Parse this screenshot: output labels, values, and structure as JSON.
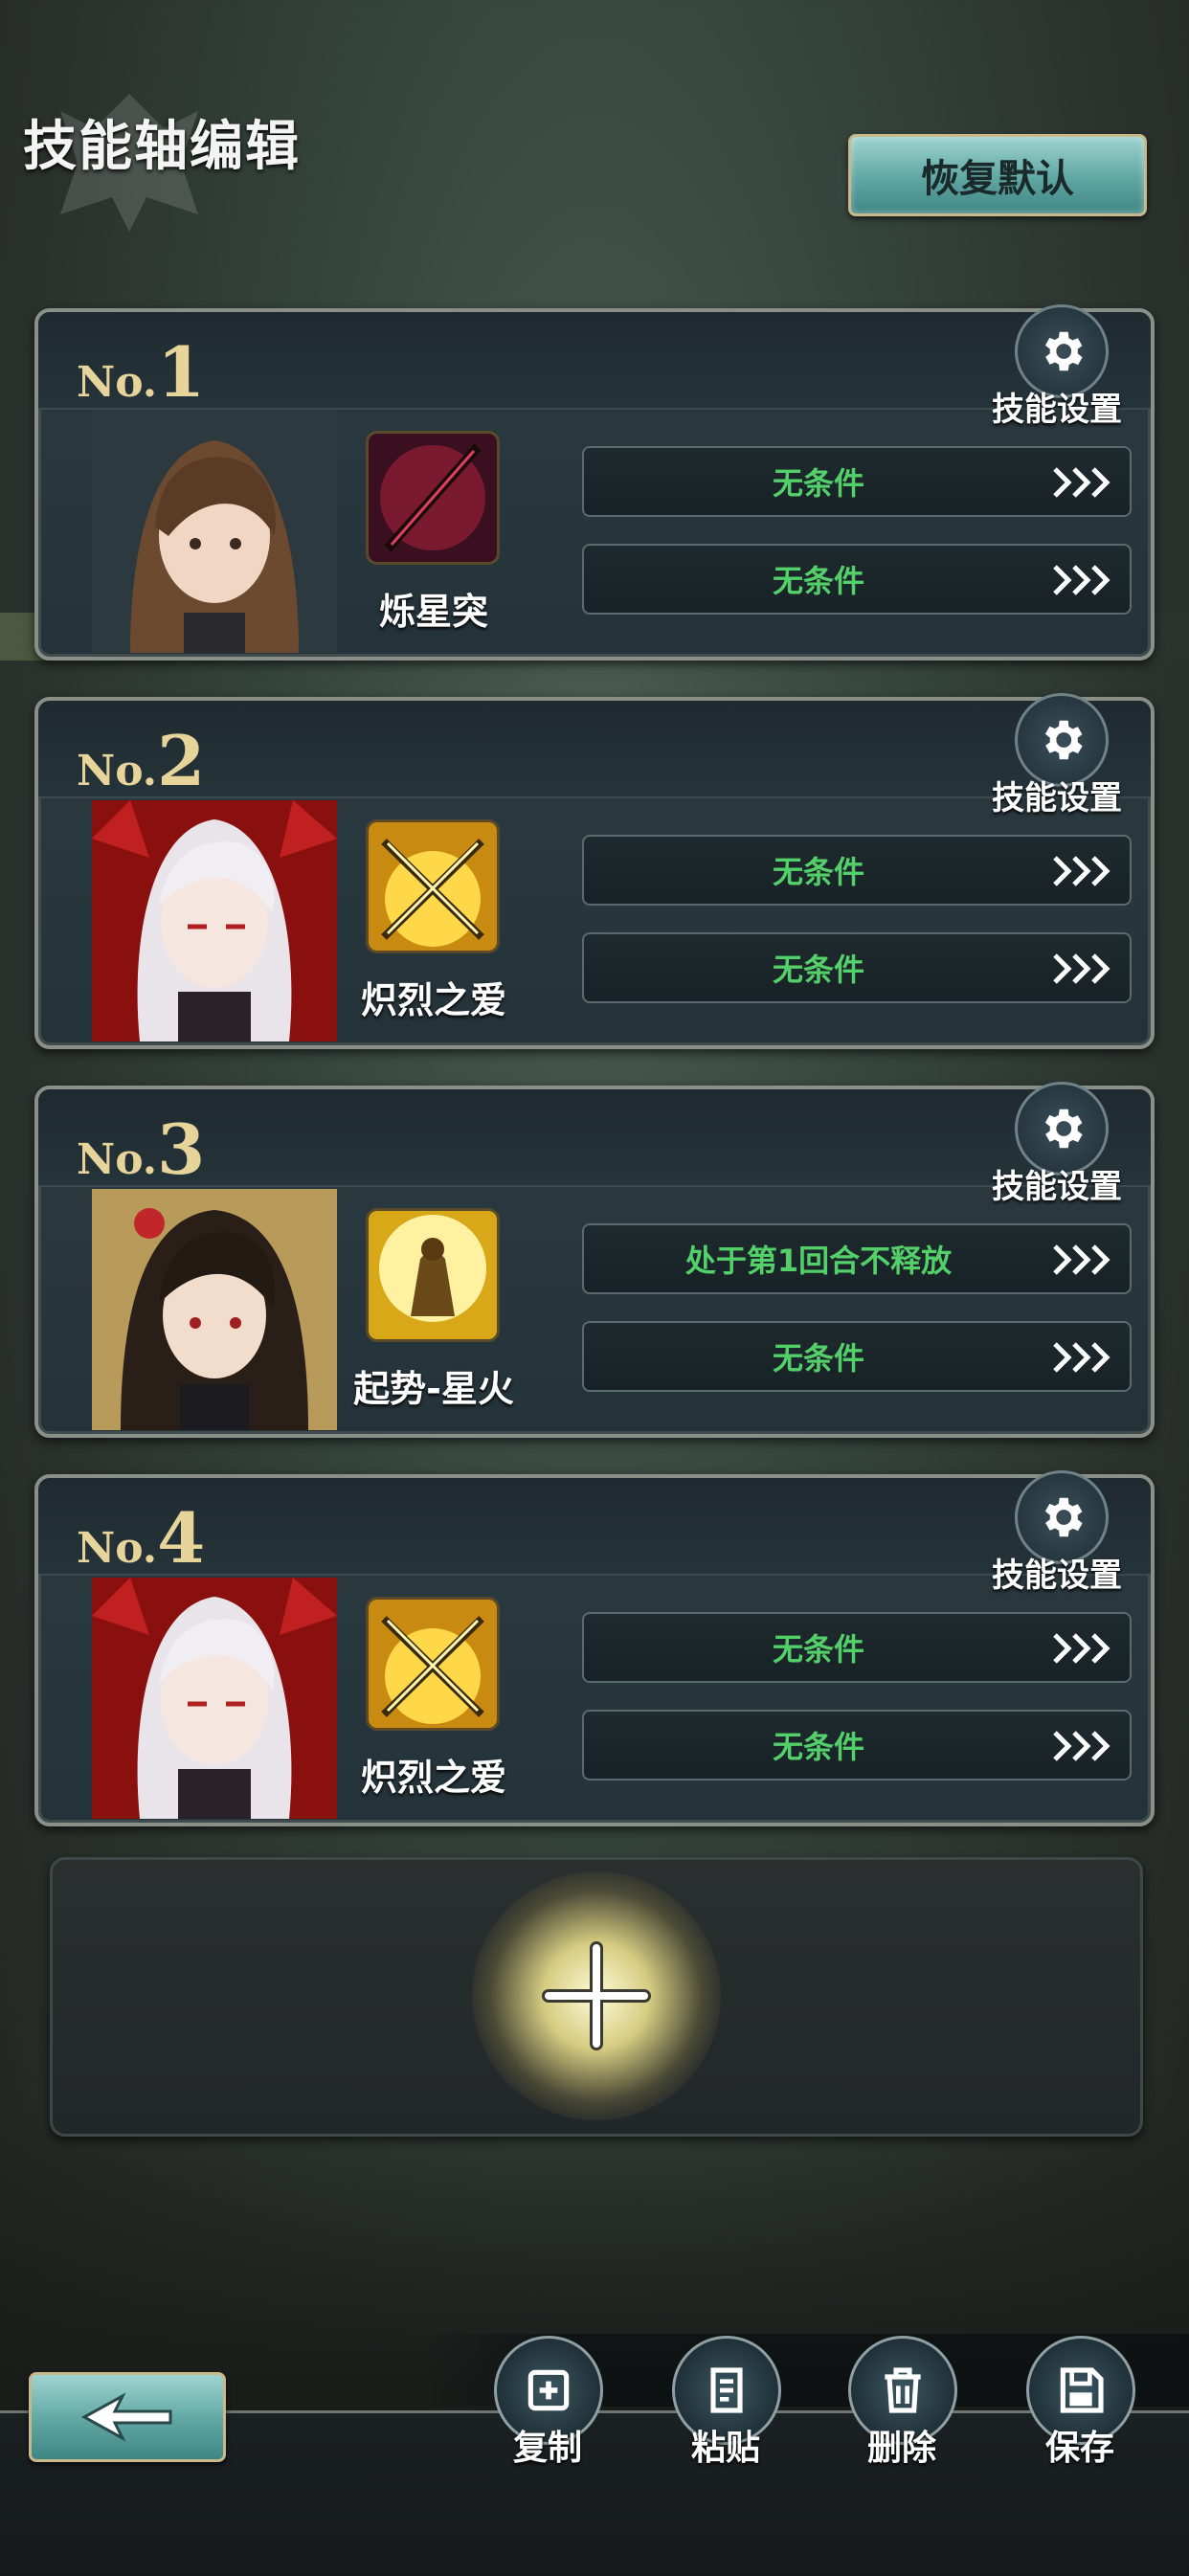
{
  "header": {
    "title": "技能轴编辑",
    "reset_label": "恢复默认"
  },
  "cards": [
    {
      "no_prefix": "No.",
      "number": "1",
      "gear_label": "技能设置",
      "skill_name": "烁星突",
      "skill_theme": "crimson-spear",
      "conditions": [
        "无条件",
        "无条件"
      ]
    },
    {
      "no_prefix": "No.",
      "number": "2",
      "gear_label": "技能设置",
      "skill_name": "炽烈之爱",
      "skill_theme": "golden-blades",
      "conditions": [
        "无条件",
        "无条件"
      ]
    },
    {
      "no_prefix": "No.",
      "number": "3",
      "gear_label": "技能设置",
      "skill_name": "起势-星火",
      "skill_theme": "golden-armor",
      "conditions": [
        "处于第1回合不释放",
        "无条件"
      ]
    },
    {
      "no_prefix": "No.",
      "number": "4",
      "gear_label": "技能设置",
      "skill_name": "炽烈之爱",
      "skill_theme": "golden-blades",
      "conditions": [
        "无条件",
        "无条件"
      ]
    }
  ],
  "add_slot": {
    "icon": "plus-icon"
  },
  "toolbar": {
    "copy": "复制",
    "paste": "粘贴",
    "delete": "删除",
    "save": "保存"
  },
  "colors": {
    "condition_text": "#54d06a",
    "number_gold": "#e6d49a",
    "button_teal": "#5fa6a3"
  }
}
